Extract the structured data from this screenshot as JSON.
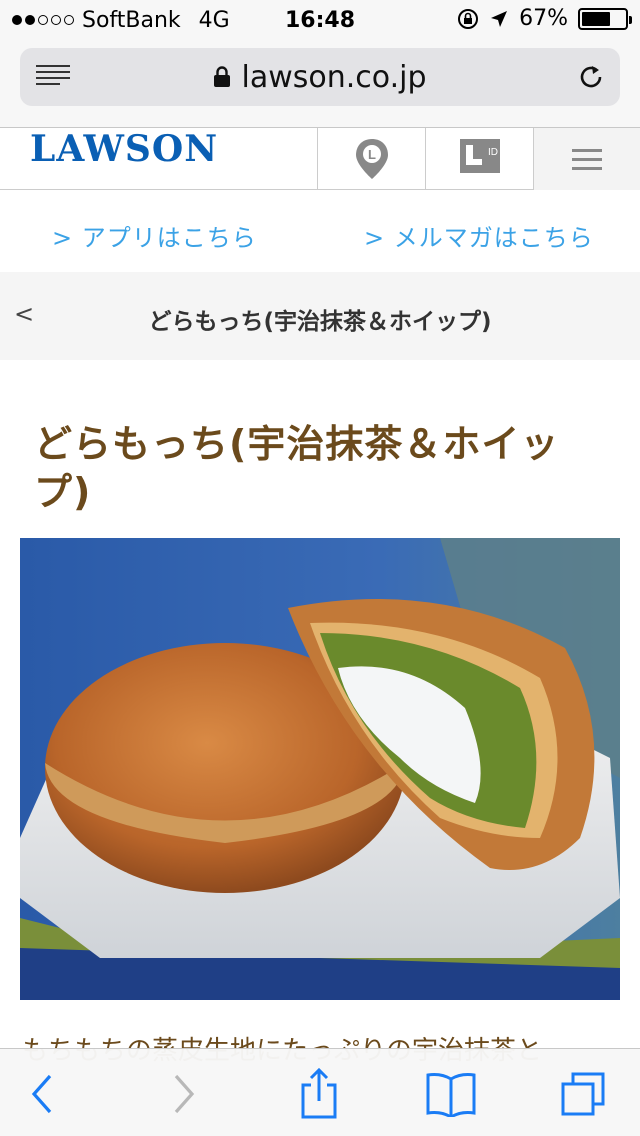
{
  "status_bar": {
    "carrier": "SoftBank",
    "network": "4G",
    "time": "16:48",
    "battery": "67%",
    "battery_level": 0.67,
    "signal_bars": 2,
    "signal_total": 5
  },
  "browser": {
    "url": "lawson.co.jp",
    "icons": [
      "reader-list-icon",
      "lock-icon",
      "reload-icon"
    ]
  },
  "site_header": {
    "logo": "LAWSON",
    "logo_color": "#0a5fb4",
    "icons": [
      "store-map-pin-icon",
      "lawson-id-icon",
      "hamburger-menu-icon"
    ]
  },
  "links": {
    "app": "> アプリはこちら",
    "mailmag": "> メルマガはこちら",
    "link_color": "#3ba2e6"
  },
  "breadcrumb": {
    "back": "<",
    "title": "どらもっち(宇治抹茶＆ホイップ)"
  },
  "product": {
    "title": "どらもっち(宇治抹茶＆ホイップ)",
    "title_color": "#6b4a1c",
    "description_start": "もちもちの蒸皮生地にたっぷりの宇治抹茶と"
  },
  "toolbar": {
    "icons": [
      "back-arrow-icon",
      "forward-arrow-icon",
      "share-icon",
      "bookmarks-icon",
      "tabs-icon"
    ],
    "accent": "#1a7cf5"
  }
}
